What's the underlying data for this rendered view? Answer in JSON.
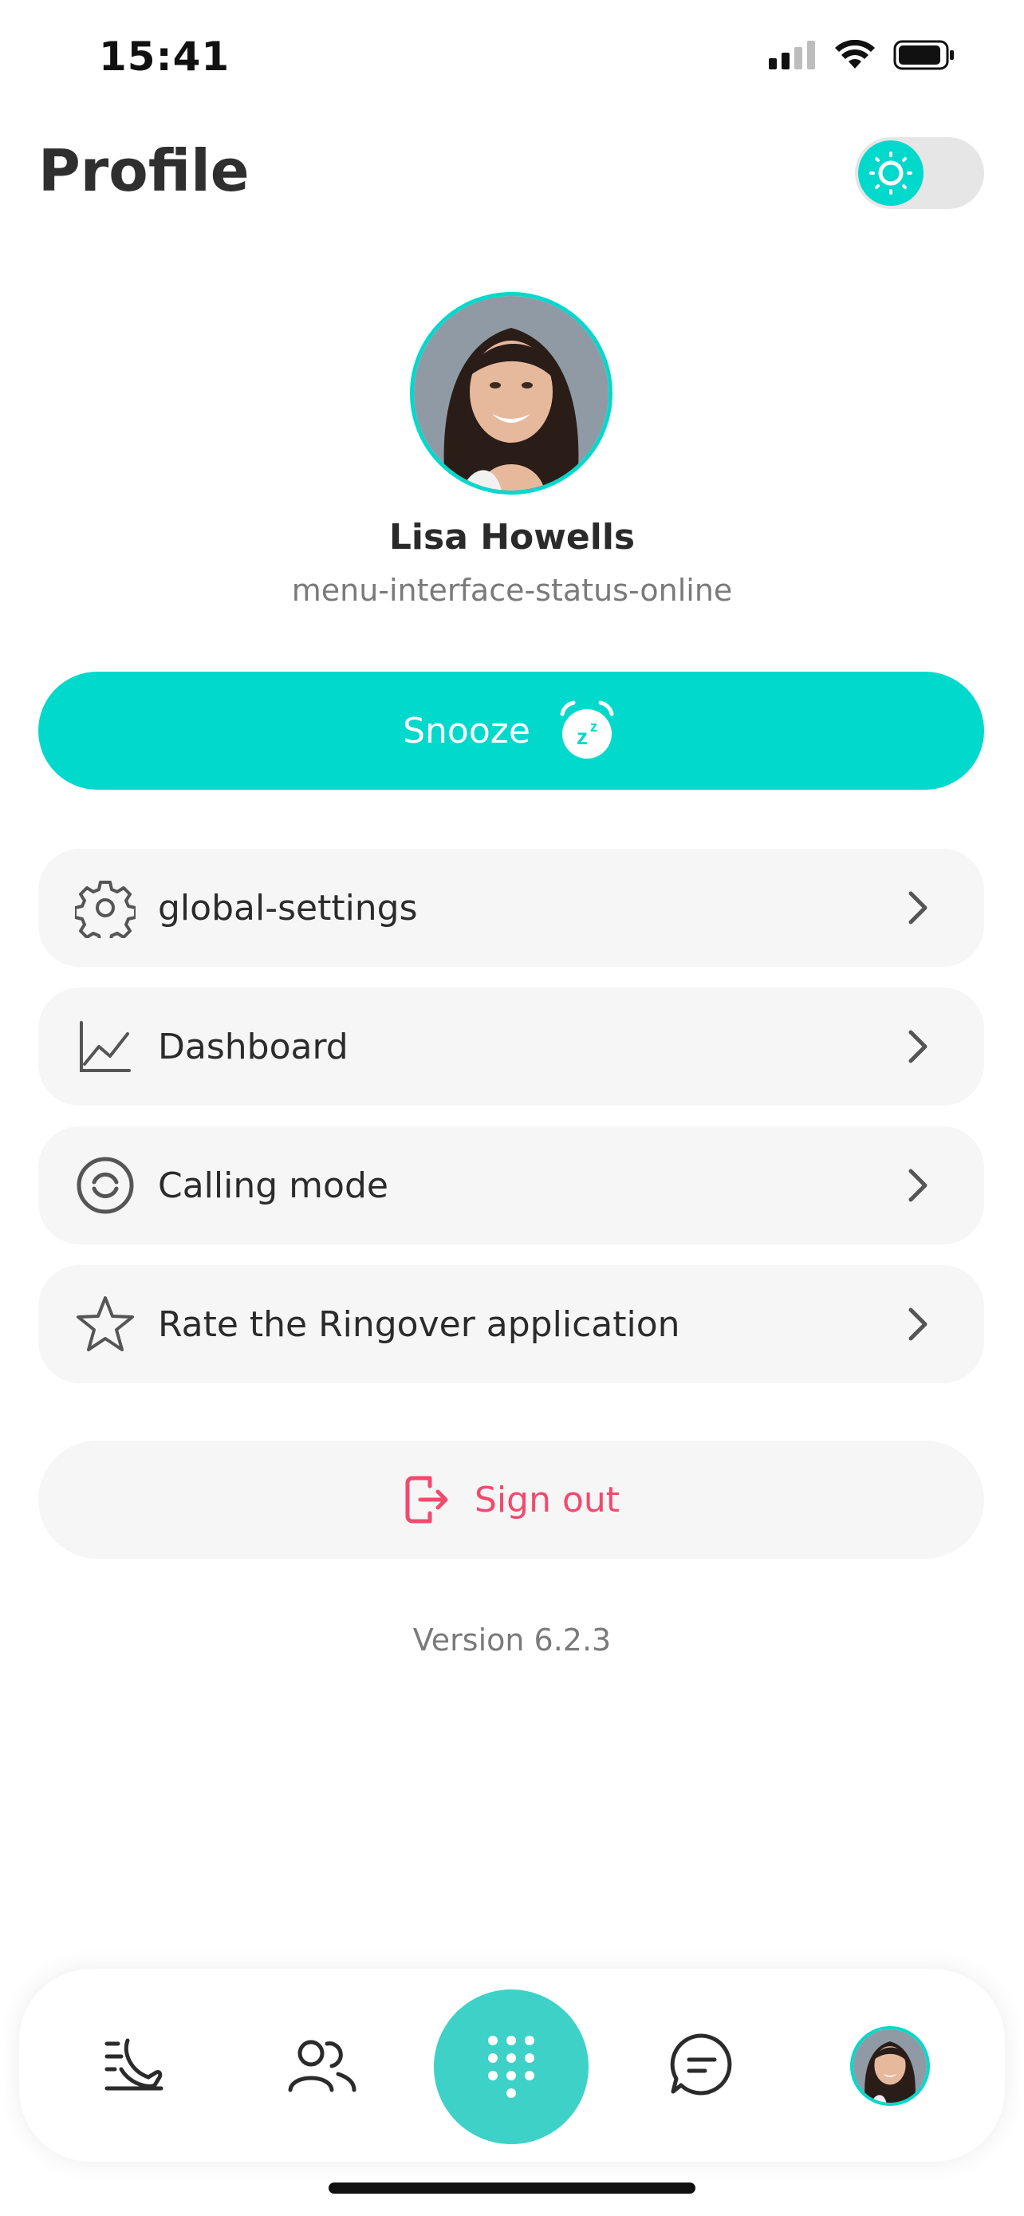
{
  "status_bar": {
    "time": "15:41",
    "icons": [
      "signal-icon",
      "wifi-icon",
      "battery-icon"
    ]
  },
  "header": {
    "title": "Profile",
    "theme_toggle_icon": "sun-icon"
  },
  "profile": {
    "name": "Lisa Howells",
    "status": "menu-interface-status-online"
  },
  "snooze": {
    "label": "Snooze",
    "icon": "snooze-alarm-icon"
  },
  "menu": {
    "items": [
      {
        "label": "global-settings",
        "icon": "gear-icon"
      },
      {
        "label": "Dashboard",
        "icon": "chart-icon"
      },
      {
        "label": "Calling mode",
        "icon": "calling-mode-icon"
      },
      {
        "label": "Rate the Ringover application",
        "icon": "star-icon"
      }
    ]
  },
  "sign_out": {
    "label": "Sign out",
    "icon": "sign-out-icon"
  },
  "version": "Version 6.2.3",
  "tabbar": {
    "tabs": [
      "call-history-icon",
      "contacts-icon",
      "dialpad-icon",
      "messages-icon",
      "profile-avatar"
    ]
  },
  "colors": {
    "accent": "#00d9cc",
    "danger": "#f24a6e",
    "card_bg": "#f6f6f6",
    "text": "#2b2b2b",
    "muted": "#7a7a7a"
  }
}
